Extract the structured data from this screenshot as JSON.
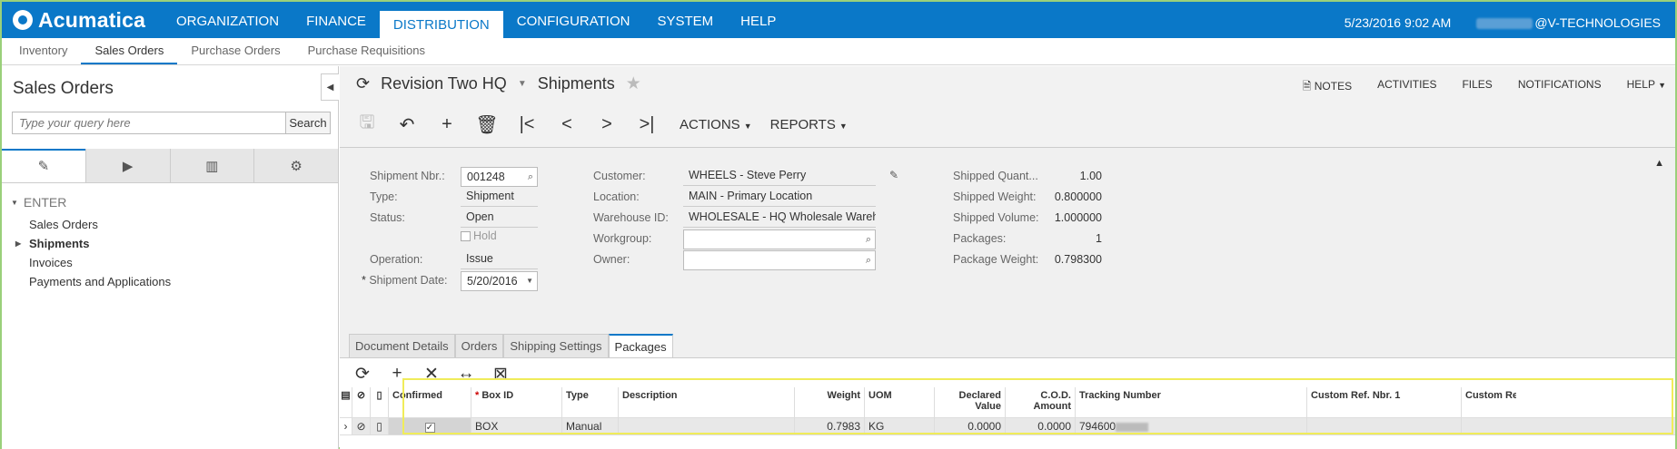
{
  "app": {
    "brand": "Acumatica",
    "nav": [
      "ORGANIZATION",
      "FINANCE",
      "DISTRIBUTION",
      "CONFIGURATION",
      "SYSTEM",
      "HELP"
    ],
    "date_time": "5/23/2016  9:02 AM",
    "user_suffix": "@V-TECHNOLOGIES"
  },
  "subnav": [
    "Inventory",
    "Sales Orders",
    "Purchase Orders",
    "Purchase Requisitions"
  ],
  "left": {
    "title": "Sales Orders",
    "search_placeholder": "Type your query here",
    "search_button": "Search",
    "group": "ENTER",
    "items": [
      "Sales Orders",
      "Shipments",
      "Invoices",
      "Payments and Applications"
    ]
  },
  "header": {
    "company": "Revision Two HQ",
    "screen": "Shipments",
    "links": [
      "NOTES",
      "ACTIVITIES",
      "FILES",
      "NOTIFICATIONS",
      "HELP"
    ],
    "actions_label": "ACTIONS",
    "reports_label": "REPORTS"
  },
  "form": {
    "shipment_nbr_label": "Shipment Nbr.:",
    "shipment_nbr": "001248",
    "type_label": "Type:",
    "type": "Shipment",
    "status_label": "Status:",
    "status": "Open",
    "hold_label": "Hold",
    "operation_label": "Operation:",
    "operation": "Issue",
    "shipment_date_label": "Shipment Date:",
    "shipment_date": "5/20/2016",
    "customer_label": "Customer:",
    "customer": "WHEELS - Steve Perry",
    "location_label": "Location:",
    "location": "MAIN - Primary Location",
    "warehouse_label": "Warehouse ID:",
    "warehouse": "WHOLESALE - HQ Wholesale Warehous",
    "workgroup_label": "Workgroup:",
    "owner_label": "Owner:",
    "shipped_qty_label": "Shipped Quant...",
    "shipped_qty": "1.00",
    "shipped_weight_label": "Shipped Weight:",
    "shipped_weight": "0.800000",
    "shipped_volume_label": "Shipped Volume:",
    "shipped_volume": "1.000000",
    "packages_label": "Packages:",
    "packages": "1",
    "package_weight_label": "Package Weight:",
    "package_weight": "0.798300"
  },
  "tabs": [
    "Document Details",
    "Orders",
    "Shipping Settings",
    "Packages"
  ],
  "grid": {
    "columns": [
      "Confirmed",
      "Box ID",
      "Type",
      "Description",
      "Weight",
      "UOM",
      "Declared Value",
      "C.O.D. Amount",
      "Tracking Number",
      "Custom Ref. Nbr. 1",
      "Custom Re"
    ],
    "row": {
      "confirmed": true,
      "box_id": "BOX",
      "type": "Manual",
      "description": "",
      "weight": "0.7983",
      "uom": "KG",
      "declared_value": "0.0000",
      "cod_amount": "0.0000",
      "tracking_number": "794600"
    }
  }
}
